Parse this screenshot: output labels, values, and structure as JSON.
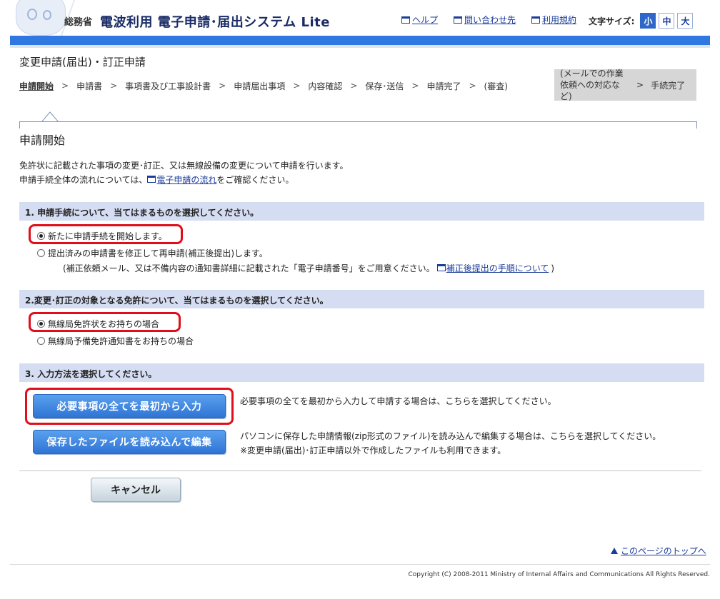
{
  "header": {
    "ministry": "総務省",
    "title": "電波利用 電子申請･届出システム Lite",
    "links": [
      {
        "label": "ヘルプ",
        "icon": "window-icon"
      },
      {
        "label": "問い合わせ先",
        "icon": "window-icon"
      },
      {
        "label": "利用規約",
        "icon": "window-icon"
      }
    ],
    "fontsize_label": "文字サイズ:",
    "fontsize_options": [
      "小",
      "中",
      "大"
    ],
    "fontsize_selected": "小"
  },
  "page": {
    "title": "変更申請(届出)・訂正申請"
  },
  "steps": {
    "items": [
      "申請開始",
      "申請書",
      "事項書及び工事設計書",
      "申請届出事項",
      "内容確認",
      "保存･送信",
      "申請完了",
      "(審査)"
    ],
    "current": "申請開始",
    "grey_box": {
      "note": "(メールでの作業依頼への対応など)",
      "final": "手続完了"
    },
    "separator": ">"
  },
  "section": {
    "heading": "申請開始",
    "intro_line1": "免許状に記載された事項の変更･訂正、又は無線設備の変更について申請を行います。",
    "intro_line2_pre": "申請手続全体の流れについては、",
    "intro_line2_link": "電子申請の流れ",
    "intro_line2_post": "をご確認ください。"
  },
  "q1": {
    "label": "1. 申請手続について、当てはまるものを選択してください。",
    "options": [
      "新たに申請手続を開始します。",
      "提出済みの申請書を修正して再申請(補正後提出)します。"
    ],
    "selected_index": 0,
    "note_pre": "(補正依頼メール、又は不備内容の通知書詳細に記載された「電子申請番号」をご用意ください。",
    "note_link": "補正後提出の手順について",
    "note_post": ")"
  },
  "q2": {
    "label": "2.変更･訂正の対象となる免許について、当てはまるものを選択してください。",
    "options": [
      "無線局免許状をお持ちの場合",
      "無線局予備免許通知書をお持ちの場合"
    ],
    "selected_index": 0
  },
  "q3": {
    "label": "3. 入力方法を選択してください。",
    "btn_new": "必要事項の全てを最初から入力",
    "btn_new_desc": "必要事項の全てを最初から入力して申請する場合は、こちらを選択してください。",
    "btn_load": "保存したファイルを読み込んで編集",
    "btn_load_desc1": "パソコンに保存した申請情報(zip形式のファイル)を読み込んで編集する場合は、こちらを選択してください。",
    "btn_load_desc2": "※変更申請(届出)･訂正申請以外で作成したファイルも利用できます。"
  },
  "cancel_label": "キャンセル",
  "page_top_link": "このページのトップへ",
  "copyright": "Copyright (C) 2008-2011 Ministry of Internal Affairs and Communications All Rights Reserved.",
  "colors": {
    "accent_blue": "#2f77e1",
    "question_bar": "#d5ddf2",
    "highlight_red": "#e10d1a"
  }
}
